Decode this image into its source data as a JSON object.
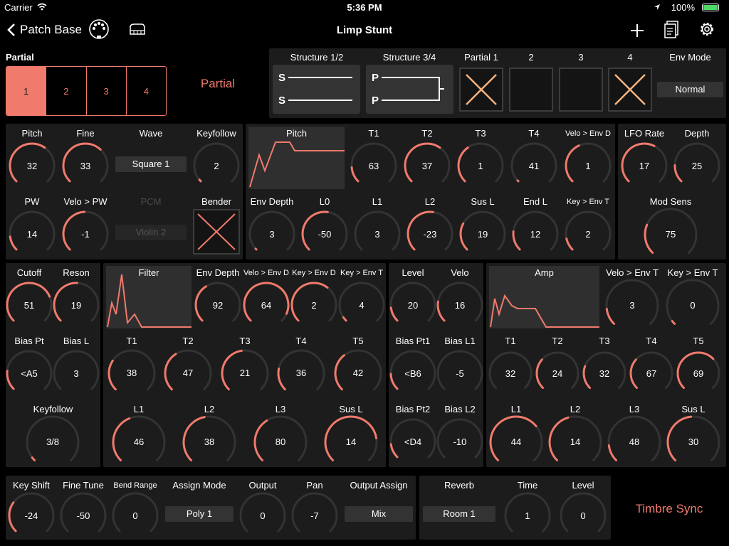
{
  "status": {
    "carrier": "Carrier",
    "time": "5:36 PM",
    "battery": "100%"
  },
  "nav": {
    "back": "Patch Base",
    "title": "Limp Stunt"
  },
  "colors": {
    "accent": "#f07a6c",
    "panel": "#1c1c1c",
    "track": "#333333"
  },
  "partial": {
    "label": "Partial",
    "tabs": [
      "1",
      "2",
      "3",
      "4"
    ],
    "selected": 0,
    "title": "Partial"
  },
  "top": {
    "structure12": "Structure 1/2",
    "structure34": "Structure 3/4",
    "s_label": "S",
    "p_label": "P",
    "partial1": "Partial 1",
    "p2": "2",
    "p3": "3",
    "p4": "4",
    "env_mode": "Env Mode",
    "env_mode_value": "Normal"
  },
  "pitch_panel": {
    "pitch": "Pitch",
    "pitch_v": "32",
    "fine": "Fine",
    "fine_v": "33",
    "wave": "Wave",
    "wave_v": "Square 1",
    "keyfollow": "Keyfollow",
    "keyfollow_v": "2",
    "pw": "PW",
    "pw_v": "14",
    "velo_pw": "Velo > PW",
    "velo_pw_v": "-1",
    "pcm": "PCM",
    "pcm_v": "Violin 2",
    "bender": "Bender"
  },
  "pitch_env": {
    "title": "Pitch",
    "t1": "T1",
    "t1_v": "63",
    "t2": "T2",
    "t2_v": "37",
    "t3": "T3",
    "t3_v": "1",
    "t4": "T4",
    "t4_v": "41",
    "velo": "Velo > Env D",
    "velo_v": "1",
    "depth": "Env Depth",
    "depth_v": "3",
    "l0": "L0",
    "l0_v": "-50",
    "l1": "L1",
    "l1_v": "3",
    "l2": "L2",
    "l2_v": "-23",
    "sus": "Sus L",
    "sus_v": "19",
    "end": "End L",
    "end_v": "12",
    "key": "Key > Env T",
    "key_v": "2"
  },
  "lfo": {
    "rate": "LFO Rate",
    "rate_v": "17",
    "depth": "Depth",
    "depth_v": "25",
    "mod": "Mod Sens",
    "mod_v": "75"
  },
  "filter_l": {
    "cutoff": "Cutoff",
    "cutoff_v": "51",
    "reson": "Reson",
    "reson_v": "19",
    "biaspt": "Bias Pt",
    "biaspt_v": "<A5",
    "biasl": "Bias L",
    "biasl_v": "3",
    "keyfollow": "Keyfollow",
    "keyfollow_v": "3/8"
  },
  "filter_env": {
    "title": "Filter",
    "depth": "Env Depth",
    "depth_v": "92",
    "velo": "Velo > Env D",
    "velo_v": "64",
    "keyd": "Key > Env D",
    "keyd_v": "2",
    "keyt": "Key > Env T",
    "keyt_v": "4",
    "t1": "T1",
    "t1_v": "38",
    "t2": "T2",
    "t2_v": "47",
    "t3": "T3",
    "t3_v": "21",
    "t4": "T4",
    "t4_v": "36",
    "t5": "T5",
    "t5_v": "42",
    "l1": "L1",
    "l1_v": "46",
    "l2": "L2",
    "l2_v": "38",
    "l3": "L3",
    "l3_v": "80",
    "sus": "Sus L",
    "sus_v": "14"
  },
  "amp_l": {
    "level": "Level",
    "level_v": "20",
    "velo": "Velo",
    "velo_v": "16",
    "bp1": "Bias Pt1",
    "bp1_v": "<B6",
    "bl1": "Bias L1",
    "bl1_v": "-5",
    "bp2": "Bias Pt2",
    "bp2_v": "<D4",
    "bl2": "Bias L2",
    "bl2_v": "-10"
  },
  "amp_env": {
    "title": "Amp",
    "velo": "Velo > Env T",
    "velo_v": "3",
    "key": "Key > Env T",
    "key_v": "0",
    "t1": "T1",
    "t1_v": "32",
    "t2": "T2",
    "t2_v": "24",
    "t3": "T3",
    "t3_v": "32",
    "t4": "T4",
    "t4_v": "67",
    "t5": "T5",
    "t5_v": "69",
    "l1": "L1",
    "l1_v": "44",
    "l2": "L2",
    "l2_v": "14",
    "l3": "L3",
    "l3_v": "48",
    "sus": "Sus L",
    "sus_v": "30"
  },
  "common": {
    "keyshift": "Key Shift",
    "keyshift_v": "-24",
    "finetune": "Fine Tune",
    "finetune_v": "-50",
    "bend": "Bend Range",
    "bend_v": "0",
    "assign": "Assign Mode",
    "assign_v": "Poly 1",
    "output": "Output",
    "output_v": "0",
    "pan": "Pan",
    "pan_v": "-7",
    "outassign": "Output Assign",
    "outassign_v": "Mix"
  },
  "reverb": {
    "reverb": "Reverb",
    "reverb_v": "Room 1",
    "time": "Time",
    "time_v": "1",
    "level": "Level",
    "level_v": "0"
  },
  "timbre_sync": "Timbre Sync",
  "knob_levels": [
    0.63,
    0.66,
    0.02,
    0.14,
    0.49,
    0.15,
    0.63,
    0.37,
    0.01,
    0.41,
    0.01,
    0.53,
    0.0,
    0.53,
    0.27,
    0.19,
    0.12,
    0.6,
    0.17,
    0.25,
    0.75,
    0.51,
    0.19,
    0.0,
    0.03,
    0.38,
    0.92,
    0.64,
    0.04,
    0.29,
    0.38,
    0.47,
    0.21,
    0.36,
    0.42,
    0.46,
    0.38,
    0.8,
    0.14,
    0.2,
    0.16,
    0.0,
    0.14,
    0.0,
    0.14,
    0.03,
    0.0,
    0.32,
    0.24,
    0.32,
    0.67,
    0.69,
    0.44,
    0.14,
    0.48,
    0.3,
    0.0,
    0.0,
    0.0,
    0.0,
    0.0,
    0.0
  ]
}
